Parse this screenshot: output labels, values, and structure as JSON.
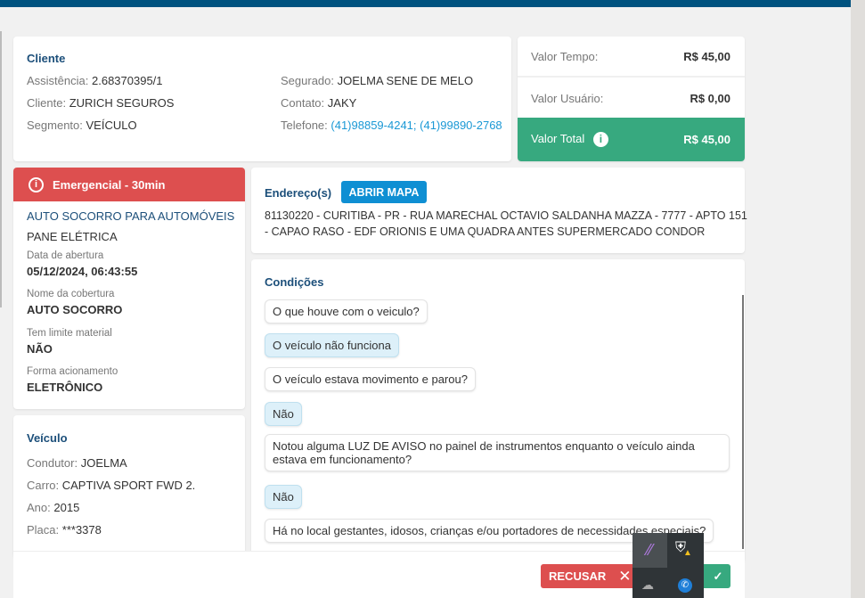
{
  "cliente": {
    "title": "Cliente",
    "assistencia_label": "Assistência:",
    "assistencia": "2.68370395/1",
    "cliente_label": "Cliente:",
    "cliente": "ZURICH SEGUROS",
    "segmento_label": "Segmento:",
    "segmento": "VEÍCULO",
    "segurado_label": "Segurado:",
    "segurado": "JOELMA SENE DE MELO",
    "contato_label": "Contato:",
    "contato": "JAKY",
    "telefone_label": "Telefone:",
    "telefone": "(41)98859-4241; (41)99890-2768"
  },
  "valores": {
    "tempo_label": "Valor Tempo:",
    "tempo": "R$ 45,00",
    "usuario_label": "Valor Usuário:",
    "usuario": "R$ 0,00",
    "total_label": "Valor Total",
    "total": "R$ 45,00",
    "total_color": "#37a97f"
  },
  "servico": {
    "badge": "Emergencial - 30min",
    "badge_color": "#dd4f4f",
    "title": "AUTO SOCORRO PARA AUTOMÓVEIS",
    "subtitle": "PANE ELÉTRICA",
    "fields": [
      {
        "label": "Data de abertura",
        "value": "05/12/2024, 06:43:55"
      },
      {
        "label": "Nome da cobertura",
        "value": "AUTO SOCORRO"
      },
      {
        "label": "Tem limite material",
        "value": "NÃO"
      },
      {
        "label": "Forma acionamento",
        "value": "ELETRÔNICO"
      }
    ]
  },
  "veiculo": {
    "title": "Veículo",
    "condutor_label": "Condutor:",
    "condutor": "JOELMA",
    "carro_label": "Carro:",
    "carro": "CAPTIVA SPORT FWD 2.",
    "ano_label": "Ano:",
    "ano": "2015",
    "placa_label": "Placa:",
    "placa": "***3378"
  },
  "endereco": {
    "title": "Endereço(s)",
    "map_button": "ABRIR MAPA",
    "line1": "81130220 - CURITIBA - PR - RUA MARECHAL OCTAVIO SALDANHA MAZZA - 7777 - APTO 151",
    "line2": "- CAPAO RASO - EDF ORIONIS E UMA QUADRA ANTES SUPERMERCADO CONDOR"
  },
  "condicoes": {
    "title": "Condições",
    "items": [
      {
        "text": "O que houve com o veiculo?"
      },
      {
        "text": "O veículo não funciona"
      },
      {
        "text": "O veículo estava movimento e parou?"
      },
      {
        "text": "Não"
      },
      {
        "text": "Notou alguma LUZ DE AVISO no painel de instrumentos enquanto o veículo ainda estava em funcionamento?"
      },
      {
        "text": "Não"
      },
      {
        "text": "Há no local gestantes, idosos, crianças e/ou portadores de necessidades especiais?"
      }
    ]
  },
  "footer": {
    "reject": "RECUSAR",
    "reject_color": "#dd4f4f",
    "accept_color": "#37a97f"
  },
  "tray": {
    "icons": [
      "feather-icon",
      "shield-warning-icon",
      "cloud-off-icon",
      "phone-icon"
    ]
  }
}
